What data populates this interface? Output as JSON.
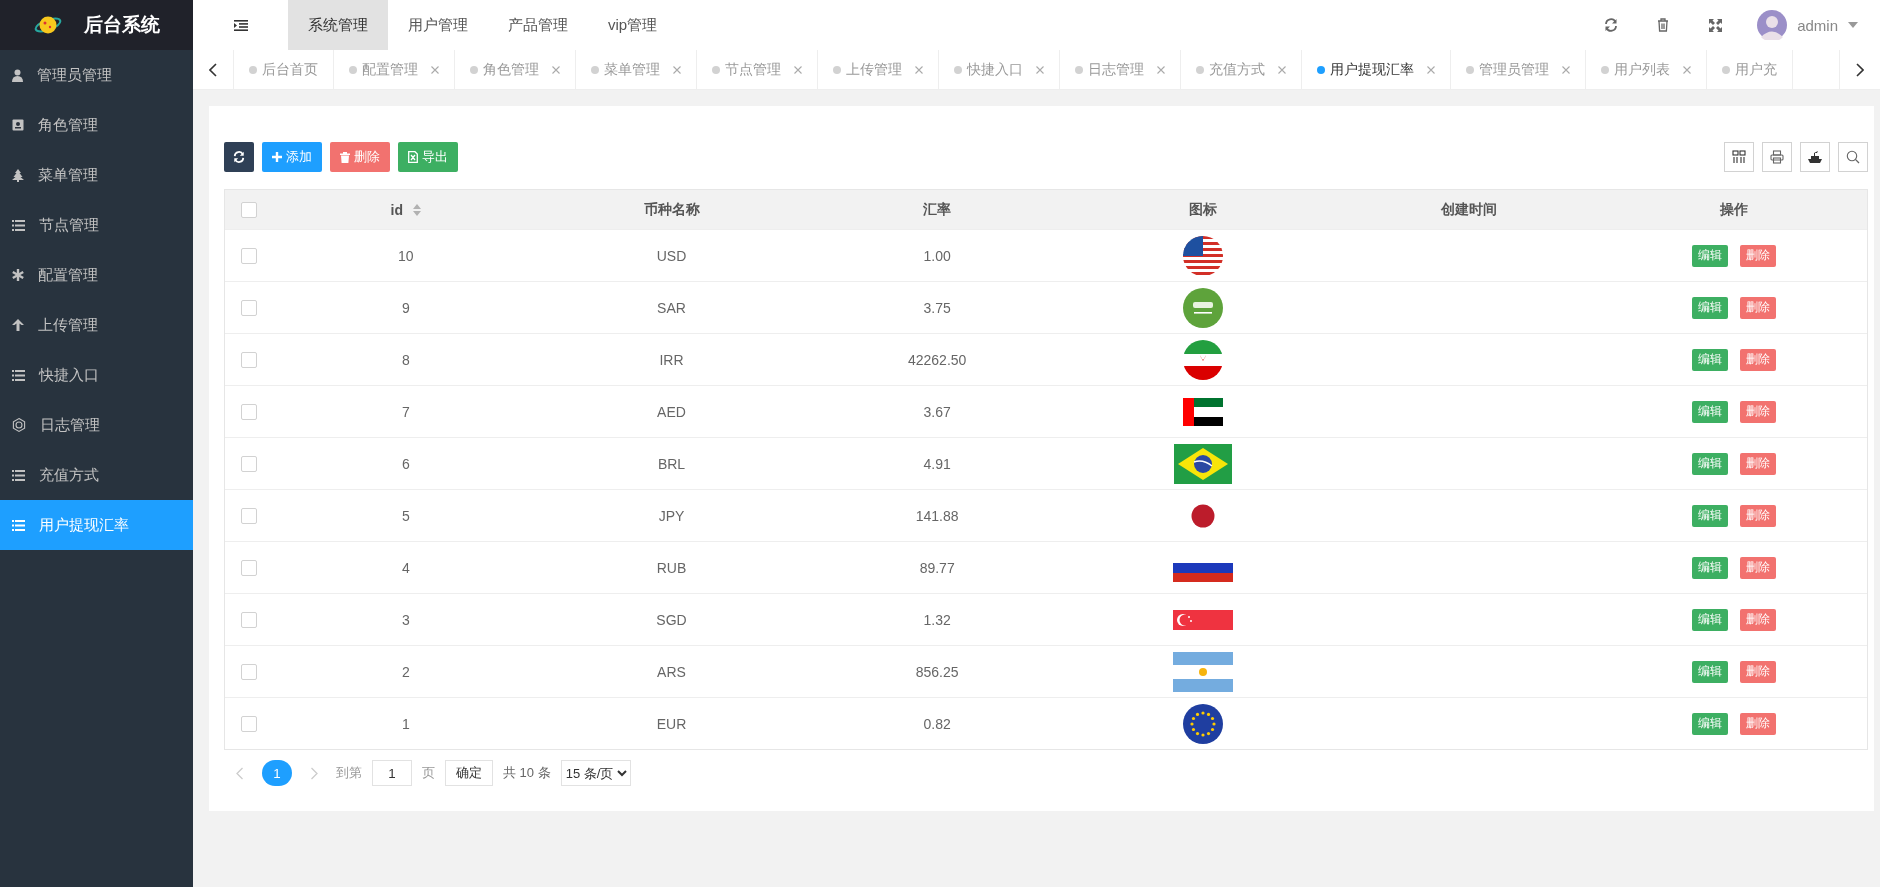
{
  "app": {
    "title": "后台系统"
  },
  "top_nav": [
    {
      "label": "系统管理",
      "selected": true
    },
    {
      "label": "用户管理",
      "selected": false
    },
    {
      "label": "产品管理",
      "selected": false
    },
    {
      "label": "vip管理",
      "selected": false
    }
  ],
  "user": {
    "name": "admin"
  },
  "sidebar": {
    "items": [
      {
        "label": "管理员管理",
        "selected": false
      },
      {
        "label": "角色管理",
        "selected": false
      },
      {
        "label": "菜单管理",
        "selected": false
      },
      {
        "label": "节点管理",
        "selected": false
      },
      {
        "label": "配置管理",
        "selected": false
      },
      {
        "label": "上传管理",
        "selected": false
      },
      {
        "label": "快捷入口",
        "selected": false
      },
      {
        "label": "日志管理",
        "selected": false
      },
      {
        "label": "充值方式",
        "selected": false
      },
      {
        "label": "用户提现汇率",
        "selected": true
      }
    ]
  },
  "tabs": [
    {
      "label": "后台首页",
      "selected": false,
      "closable": false
    },
    {
      "label": "配置管理",
      "selected": false,
      "closable": true
    },
    {
      "label": "角色管理",
      "selected": false,
      "closable": true
    },
    {
      "label": "菜单管理",
      "selected": false,
      "closable": true
    },
    {
      "label": "节点管理",
      "selected": false,
      "closable": true
    },
    {
      "label": "上传管理",
      "selected": false,
      "closable": true
    },
    {
      "label": "快捷入口",
      "selected": false,
      "closable": true
    },
    {
      "label": "日志管理",
      "selected": false,
      "closable": true
    },
    {
      "label": "充值方式",
      "selected": false,
      "closable": true
    },
    {
      "label": "用户提现汇率",
      "selected": true,
      "closable": true
    },
    {
      "label": "管理员管理",
      "selected": false,
      "closable": true
    },
    {
      "label": "用户列表",
      "selected": false,
      "closable": true
    },
    {
      "label": "用户充",
      "selected": false,
      "closable": false
    }
  ],
  "toolbar": [
    {
      "kind": "refresh"
    },
    {
      "kind": "add",
      "label": "添加"
    },
    {
      "kind": "delete",
      "label": "删除"
    },
    {
      "kind": "export",
      "label": "导出"
    }
  ],
  "table": {
    "header_checked": false,
    "columns": [
      {
        "label": "id",
        "sortable": true
      },
      {
        "label": "币种名称",
        "sortable": false
      },
      {
        "label": "汇率",
        "sortable": false
      },
      {
        "label": "图标",
        "sortable": false
      },
      {
        "label": "创建时间",
        "sortable": false
      },
      {
        "label": "操作",
        "sortable": false
      }
    ],
    "rows": [
      {
        "checked": false,
        "id": "10",
        "currency": "USD",
        "rate": "1.00",
        "edit": "编辑",
        "delete": "删除"
      },
      {
        "checked": false,
        "id": "9",
        "currency": "SAR",
        "rate": "3.75",
        "edit": "编辑",
        "delete": "删除"
      },
      {
        "checked": false,
        "id": "8",
        "currency": "IRR",
        "rate": "42262.50",
        "edit": "编辑",
        "delete": "删除"
      },
      {
        "checked": false,
        "id": "7",
        "currency": "AED",
        "rate": "3.67",
        "edit": "编辑",
        "delete": "删除"
      },
      {
        "checked": false,
        "id": "6",
        "currency": "BRL",
        "rate": "4.91",
        "edit": "编辑",
        "delete": "删除"
      },
      {
        "checked": false,
        "id": "5",
        "currency": "JPY",
        "rate": "141.88",
        "edit": "编辑",
        "delete": "删除"
      },
      {
        "checked": false,
        "id": "4",
        "currency": "RUB",
        "rate": "89.77",
        "edit": "编辑",
        "delete": "删除"
      },
      {
        "checked": false,
        "id": "3",
        "currency": "SGD",
        "rate": "1.32",
        "edit": "编辑",
        "delete": "删除"
      },
      {
        "checked": false,
        "id": "2",
        "currency": "ARS",
        "rate": "856.25",
        "edit": "编辑",
        "delete": "删除"
      },
      {
        "checked": false,
        "id": "1",
        "currency": "EUR",
        "rate": "0.82",
        "edit": "编辑",
        "delete": "删除"
      }
    ]
  },
  "pagination": {
    "pages": [
      {
        "label": "1",
        "selected": true
      }
    ],
    "goto_label": "到第",
    "page_input": "1",
    "page_unit": "页",
    "confirm": "确定",
    "total": "共 10 条",
    "page_size": "15 条/页"
  }
}
